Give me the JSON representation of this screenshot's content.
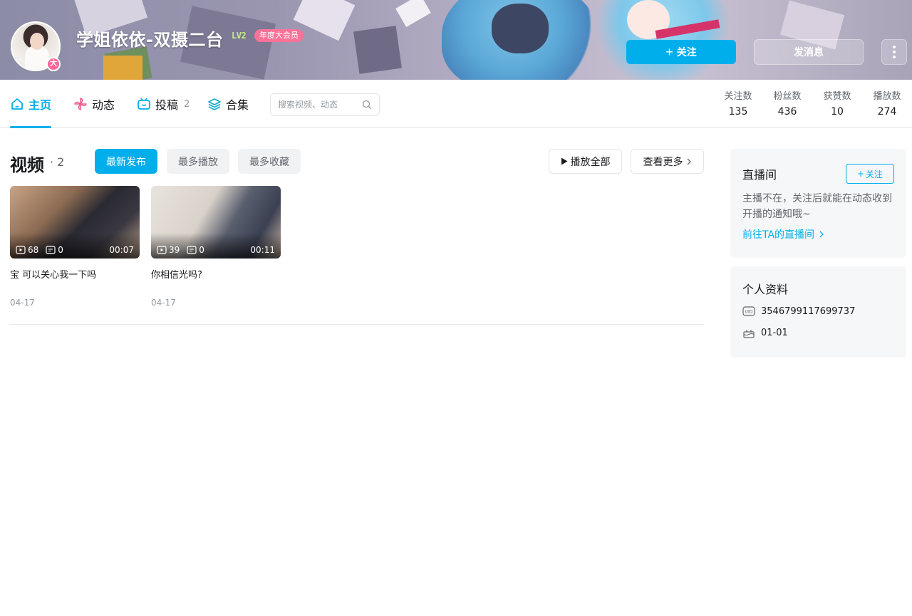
{
  "header": {
    "username": "学姐依依-双摄二台",
    "level": "LV2",
    "vip_badge": "年度大会员",
    "avatar_badge": "大",
    "follow_label": "关注",
    "message_label": "发消息"
  },
  "nav": {
    "tabs": [
      {
        "label": "主页",
        "icon": "home-icon",
        "count": ""
      },
      {
        "label": "动态",
        "icon": "pinwheel-icon",
        "count": ""
      },
      {
        "label": "投稿",
        "icon": "tv-icon",
        "count": "2"
      },
      {
        "label": "合集",
        "icon": "layers-icon",
        "count": ""
      }
    ],
    "search_placeholder": "搜索视频、动态",
    "stats": [
      {
        "label": "关注数",
        "value": "135"
      },
      {
        "label": "粉丝数",
        "value": "436"
      },
      {
        "label": "获赞数",
        "value": "10"
      },
      {
        "label": "播放数",
        "value": "274"
      }
    ]
  },
  "videos": {
    "title": "视频",
    "count": "· 2",
    "sort": [
      "最新发布",
      "最多播放",
      "最多收藏"
    ],
    "play_all": "播放全部",
    "see_more": "查看更多",
    "items": [
      {
        "title": "宝 可以关心我一下吗",
        "plays": "68",
        "danmaku": "0",
        "duration": "00:07",
        "date": "04-17"
      },
      {
        "title": "你相信光吗?",
        "plays": "39",
        "danmaku": "0",
        "duration": "00:11",
        "date": "04-17"
      }
    ]
  },
  "live": {
    "title": "直播间",
    "follow_label": "关注",
    "desc": "主播不在，关注后就能在动态收到开播的通知哦~",
    "link": "前往TA的直播间"
  },
  "profile": {
    "title": "个人资料",
    "uid_icon_text": "UID",
    "uid": "3546799117699737",
    "birthday": "01-01"
  },
  "colors": {
    "accent": "#00aeec",
    "pink": "#fb7299"
  }
}
